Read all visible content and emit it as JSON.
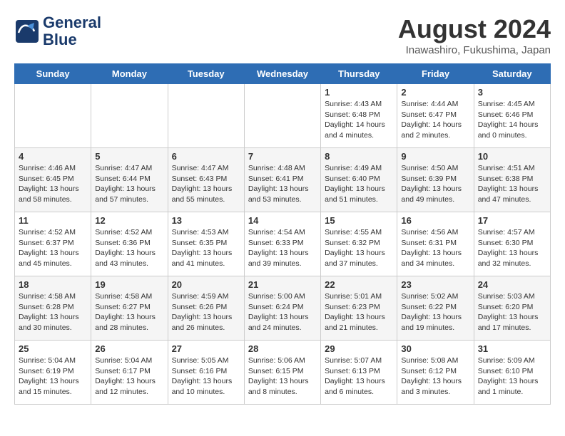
{
  "logo": {
    "line1": "General",
    "line2": "Blue"
  },
  "title": "August 2024",
  "subtitle": "Inawashiro, Fukushima, Japan",
  "headers": [
    "Sunday",
    "Monday",
    "Tuesday",
    "Wednesday",
    "Thursday",
    "Friday",
    "Saturday"
  ],
  "weeks": [
    [
      {
        "day": "",
        "info": ""
      },
      {
        "day": "",
        "info": ""
      },
      {
        "day": "",
        "info": ""
      },
      {
        "day": "",
        "info": ""
      },
      {
        "day": "1",
        "info": "Sunrise: 4:43 AM\nSunset: 6:48 PM\nDaylight: 14 hours\nand 4 minutes."
      },
      {
        "day": "2",
        "info": "Sunrise: 4:44 AM\nSunset: 6:47 PM\nDaylight: 14 hours\nand 2 minutes."
      },
      {
        "day": "3",
        "info": "Sunrise: 4:45 AM\nSunset: 6:46 PM\nDaylight: 14 hours\nand 0 minutes."
      }
    ],
    [
      {
        "day": "4",
        "info": "Sunrise: 4:46 AM\nSunset: 6:45 PM\nDaylight: 13 hours\nand 58 minutes."
      },
      {
        "day": "5",
        "info": "Sunrise: 4:47 AM\nSunset: 6:44 PM\nDaylight: 13 hours\nand 57 minutes."
      },
      {
        "day": "6",
        "info": "Sunrise: 4:47 AM\nSunset: 6:43 PM\nDaylight: 13 hours\nand 55 minutes."
      },
      {
        "day": "7",
        "info": "Sunrise: 4:48 AM\nSunset: 6:41 PM\nDaylight: 13 hours\nand 53 minutes."
      },
      {
        "day": "8",
        "info": "Sunrise: 4:49 AM\nSunset: 6:40 PM\nDaylight: 13 hours\nand 51 minutes."
      },
      {
        "day": "9",
        "info": "Sunrise: 4:50 AM\nSunset: 6:39 PM\nDaylight: 13 hours\nand 49 minutes."
      },
      {
        "day": "10",
        "info": "Sunrise: 4:51 AM\nSunset: 6:38 PM\nDaylight: 13 hours\nand 47 minutes."
      }
    ],
    [
      {
        "day": "11",
        "info": "Sunrise: 4:52 AM\nSunset: 6:37 PM\nDaylight: 13 hours\nand 45 minutes."
      },
      {
        "day": "12",
        "info": "Sunrise: 4:52 AM\nSunset: 6:36 PM\nDaylight: 13 hours\nand 43 minutes."
      },
      {
        "day": "13",
        "info": "Sunrise: 4:53 AM\nSunset: 6:35 PM\nDaylight: 13 hours\nand 41 minutes."
      },
      {
        "day": "14",
        "info": "Sunrise: 4:54 AM\nSunset: 6:33 PM\nDaylight: 13 hours\nand 39 minutes."
      },
      {
        "day": "15",
        "info": "Sunrise: 4:55 AM\nSunset: 6:32 PM\nDaylight: 13 hours\nand 37 minutes."
      },
      {
        "day": "16",
        "info": "Sunrise: 4:56 AM\nSunset: 6:31 PM\nDaylight: 13 hours\nand 34 minutes."
      },
      {
        "day": "17",
        "info": "Sunrise: 4:57 AM\nSunset: 6:30 PM\nDaylight: 13 hours\nand 32 minutes."
      }
    ],
    [
      {
        "day": "18",
        "info": "Sunrise: 4:58 AM\nSunset: 6:28 PM\nDaylight: 13 hours\nand 30 minutes."
      },
      {
        "day": "19",
        "info": "Sunrise: 4:58 AM\nSunset: 6:27 PM\nDaylight: 13 hours\nand 28 minutes."
      },
      {
        "day": "20",
        "info": "Sunrise: 4:59 AM\nSunset: 6:26 PM\nDaylight: 13 hours\nand 26 minutes."
      },
      {
        "day": "21",
        "info": "Sunrise: 5:00 AM\nSunset: 6:24 PM\nDaylight: 13 hours\nand 24 minutes."
      },
      {
        "day": "22",
        "info": "Sunrise: 5:01 AM\nSunset: 6:23 PM\nDaylight: 13 hours\nand 21 minutes."
      },
      {
        "day": "23",
        "info": "Sunrise: 5:02 AM\nSunset: 6:22 PM\nDaylight: 13 hours\nand 19 minutes."
      },
      {
        "day": "24",
        "info": "Sunrise: 5:03 AM\nSunset: 6:20 PM\nDaylight: 13 hours\nand 17 minutes."
      }
    ],
    [
      {
        "day": "25",
        "info": "Sunrise: 5:04 AM\nSunset: 6:19 PM\nDaylight: 13 hours\nand 15 minutes."
      },
      {
        "day": "26",
        "info": "Sunrise: 5:04 AM\nSunset: 6:17 PM\nDaylight: 13 hours\nand 12 minutes."
      },
      {
        "day": "27",
        "info": "Sunrise: 5:05 AM\nSunset: 6:16 PM\nDaylight: 13 hours\nand 10 minutes."
      },
      {
        "day": "28",
        "info": "Sunrise: 5:06 AM\nSunset: 6:15 PM\nDaylight: 13 hours\nand 8 minutes."
      },
      {
        "day": "29",
        "info": "Sunrise: 5:07 AM\nSunset: 6:13 PM\nDaylight: 13 hours\nand 6 minutes."
      },
      {
        "day": "30",
        "info": "Sunrise: 5:08 AM\nSunset: 6:12 PM\nDaylight: 13 hours\nand 3 minutes."
      },
      {
        "day": "31",
        "info": "Sunrise: 5:09 AM\nSunset: 6:10 PM\nDaylight: 13 hours\nand 1 minute."
      }
    ]
  ]
}
